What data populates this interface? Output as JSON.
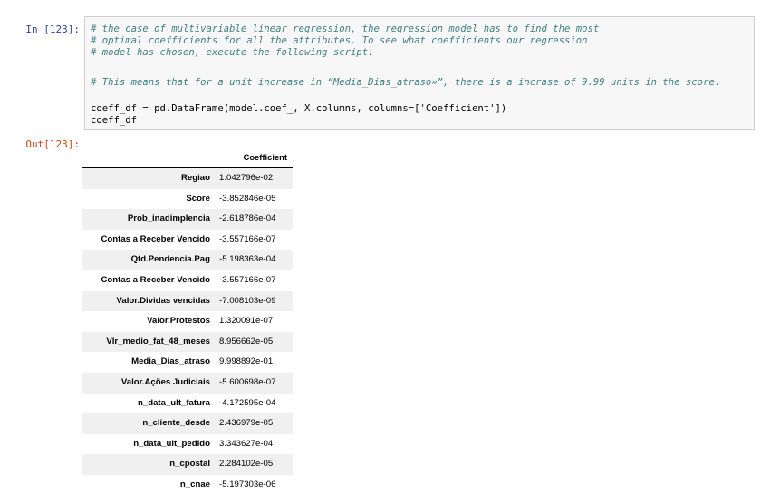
{
  "input_cell": {
    "prompt": "In [123]:",
    "lines": [
      "# the case of multivariable linear regression, the regression model has to find the most",
      "# optimal coefficients for all the attributes. To see what coefficients our regression",
      "# model has chosen, execute the following script:",
      "",
      "# This means that for a unit increase in “Media_Dias_atraso»”, there is a incrase of 9.99 units in the score.",
      "",
      "coeff_df = pd.DataFrame(model.coef_, X.columns, columns=['Coefficient'])",
      "coeff_df"
    ]
  },
  "output_cell": {
    "prompt": "Out[123]:",
    "column_header": "Coefficient",
    "rows": [
      {
        "index": "Regiao",
        "value": "1.042796e-02"
      },
      {
        "index": "Score",
        "value": "-3.852846e-05"
      },
      {
        "index": "Prob_inadimplencia",
        "value": "-2.618786e-04"
      },
      {
        "index": "Contas a Receber Vencido",
        "value": "-3.557166e-07"
      },
      {
        "index": "Qtd.Pendencia.Pag",
        "value": "-5.198363e-04"
      },
      {
        "index": "Contas a Receber Vencido",
        "value": "-3.557166e-07"
      },
      {
        "index": "Valor.Dividas vencidas",
        "value": "-7.008103e-09"
      },
      {
        "index": "Valor.Protestos",
        "value": "1.320091e-07"
      },
      {
        "index": "Vlr_medio_fat_48_meses",
        "value": "8.956662e-05"
      },
      {
        "index": "Media_Dias_atraso",
        "value": "9.998892e-01"
      },
      {
        "index": "Valor.Ações Judiciais",
        "value": "-5.600698e-07"
      },
      {
        "index": "n_data_ult_fatura",
        "value": "-4.172595e-04"
      },
      {
        "index": "n_cliente_desde",
        "value": "2.436979e-05"
      },
      {
        "index": "n_data_ult_pedido",
        "value": "3.343627e-04"
      },
      {
        "index": "n_cpostal",
        "value": "2.284102e-05"
      },
      {
        "index": "n_cnae",
        "value": "-5.197303e-06"
      }
    ]
  }
}
